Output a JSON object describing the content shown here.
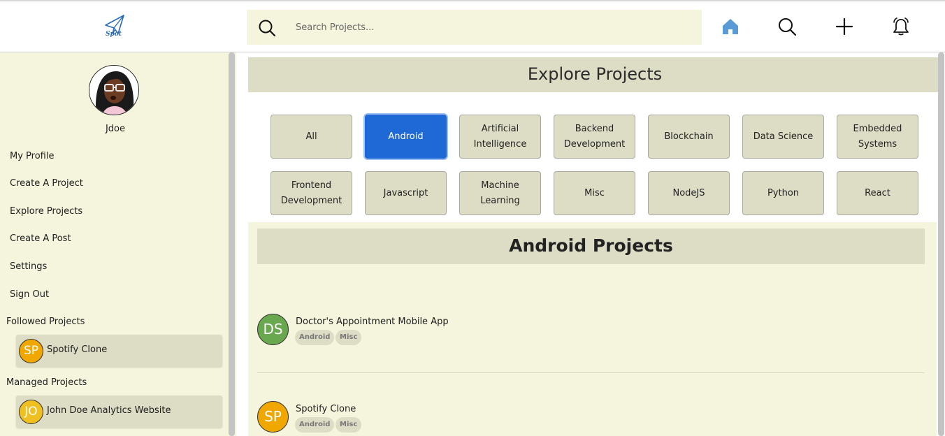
{
  "app": {
    "logo_text": "Spot"
  },
  "header": {
    "search_placeholder": "Search Projects..."
  },
  "sidebar": {
    "username": "Jdoe",
    "menu": [
      {
        "label": "My Profile"
      },
      {
        "label": "Create A Project"
      },
      {
        "label": "Explore Projects"
      },
      {
        "label": "Create A Post"
      },
      {
        "label": "Settings"
      },
      {
        "label": "Sign Out"
      }
    ],
    "followed_label": "Followed Projects",
    "followed": [
      {
        "initials": "SP",
        "name": "Spotify Clone",
        "color": "#f0a800"
      }
    ],
    "managed_label": "Managed Projects",
    "managed": [
      {
        "initials": "JO",
        "name": "John Doe Analytics Website",
        "color": "#f0c020"
      }
    ]
  },
  "main": {
    "explore_title": "Explore Projects",
    "categories": [
      {
        "label": "All",
        "active": false
      },
      {
        "label": "Android",
        "active": true
      },
      {
        "label": "Artificial Intelligence",
        "active": false
      },
      {
        "label": "Backend Development",
        "active": false
      },
      {
        "label": "Blockchain",
        "active": false
      },
      {
        "label": "Data Science",
        "active": false
      },
      {
        "label": "Embedded Systems",
        "active": false
      },
      {
        "label": "Frontend Development",
        "active": false
      },
      {
        "label": "Javascript",
        "active": false
      },
      {
        "label": "Machine Learning",
        "active": false
      },
      {
        "label": "Misc",
        "active": false
      },
      {
        "label": "NodeJS",
        "active": false
      },
      {
        "label": "Python",
        "active": false
      },
      {
        "label": "React",
        "active": false
      }
    ],
    "projects_title": "Android Projects",
    "projects": [
      {
        "initials": "DS",
        "name": "Doctor's Appointment Mobile App",
        "color": "#6aa84f",
        "tags": [
          "Android",
          "Misc"
        ]
      },
      {
        "initials": "SP",
        "name": "Spotify Clone",
        "color": "#f0a800",
        "tags": [
          "Android",
          "Misc"
        ]
      }
    ]
  },
  "colors": {
    "accent": "#1f69d6",
    "panel": "#f5f4dc",
    "card": "#dddcc4",
    "home_icon": "#5b9bd5"
  },
  "icons": [
    "logo-paper-plane-icon",
    "search-icon",
    "home-icon",
    "plus-icon",
    "bell-icon"
  ]
}
